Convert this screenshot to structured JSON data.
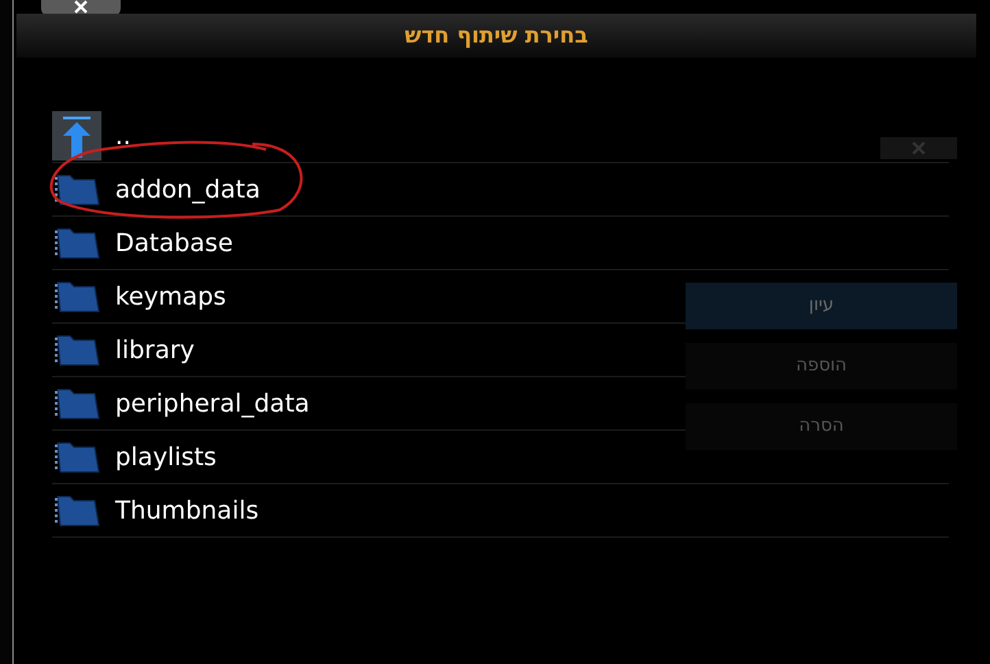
{
  "dialog": {
    "title": "בחירת שיתוף חדש",
    "items": [
      {
        "label": "..",
        "kind": "parent",
        "circled": false
      },
      {
        "label": "addon_data",
        "kind": "folder",
        "circled": true
      },
      {
        "label": "Database",
        "kind": "folder",
        "circled": false
      },
      {
        "label": "keymaps",
        "kind": "folder",
        "circled": false
      },
      {
        "label": "library",
        "kind": "folder",
        "circled": false
      },
      {
        "label": "peripheral_data",
        "kind": "folder",
        "circled": false
      },
      {
        "label": "playlists",
        "kind": "folder",
        "circled": false
      },
      {
        "label": "Thumbnails",
        "kind": "folder",
        "circled": false
      }
    ]
  },
  "background_dialog": {
    "buttons": [
      {
        "label": "עיון",
        "selected": true
      },
      {
        "label": "הוספה",
        "selected": false
      },
      {
        "label": "הסרה",
        "selected": false
      }
    ]
  }
}
